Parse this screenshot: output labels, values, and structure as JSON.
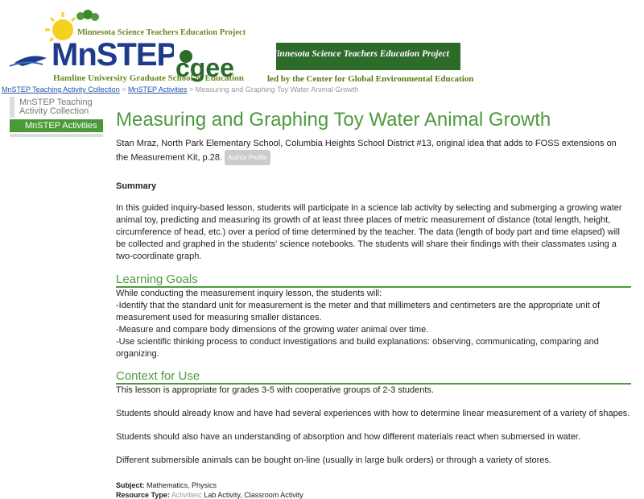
{
  "header": {
    "mnstep_top": "Minnesota Science Teachers Education Project",
    "mnstep_logo": "MnSTEP",
    "mnstep_bottom": "Hamline University Graduate School of Education",
    "cgee_logo": "cgee",
    "cgee_tagline": "Minnesota Science Teachers Education Project",
    "cgee_sub": "led by the Center for Global Environmental Education"
  },
  "breadcrumb": {
    "item1": "MnSTEP Teaching Activity Collection",
    "item2": "MnSTEP Activities",
    "current": "Measuring and Graphing Toy Water Animal Growth"
  },
  "sidebar": {
    "item1": "MnSTEP Teaching Activity Collection",
    "item2": "MnSTEP Activities"
  },
  "main": {
    "title": "Measuring and Graphing Toy Water Animal Growth",
    "author": "Stan Mraz, North Park Elementary School, Columbia Heights School District #13, original idea that adds to FOSS extensions on the Measurement Kit, p.28.",
    "author_btn": "Author Profile",
    "summary_heading": "Summary",
    "summary": "In this guided inquiry-based lesson, students will participate in a science lab activity by selecting and submerging a growing water animal toy, predicting and measuring its growth of at least three places of metric measurement of distance (total length, height, circumference of head, etc.) over a period of time determined by the teacher. The data (length of body part and time elapsed) will be collected and graphed in the students' science notebooks. The students will share their findings with their classmates using a two-coordinate graph.",
    "learning_goals_heading": "Learning Goals",
    "goals": [
      "While conducting the measurement inquiry lesson, the students will:",
      "-Identify that the standard unit for measurement is the meter and that millimeters and centimeters are the appropriate unit of measurement used for measuring smaller distances.",
      "-Measure and compare body dimensions of the growing water animal over time.",
      "-Use scientific thinking process to conduct investigations and build explanations: observing, communicating, comparing and organizing."
    ],
    "context_heading": "Context for Use",
    "context": [
      "This lesson is appropriate for grades 3-5 with cooperative groups of 2-3 students.",
      "Students should already know and have had several experiences with how to determine linear measurement of a variety of shapes.",
      "Students should also have an understanding of absorption and how different materials react when submersed in water.",
      "Different submersible animals can be bought on-line (usually in large bulk orders) or through a variety of stores."
    ],
    "subject_label": "Subject:",
    "subject_value": "Mathematics, Physics",
    "resource_label": "Resource Type:",
    "resource_value": "Activities",
    "resource_rest": ": Lab Activity, Classroom Activity"
  }
}
